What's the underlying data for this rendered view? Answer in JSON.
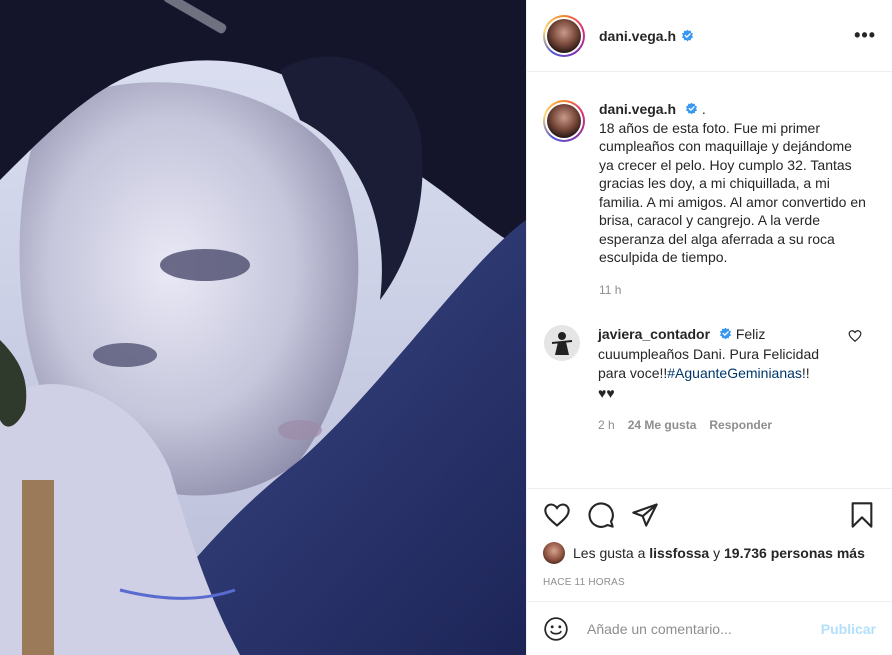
{
  "post": {
    "author": "dani.vega.h",
    "caption_suffix": ".",
    "caption_text": "18 años de esta foto. Fue mi primer cumpleaños con maquillaje y dejándome ya crecer el pelo. Hoy cumplo 32. Tantas gracias les doy, a mi chiquillada, a mi familia. A mi amigos. Al amor convertido en brisa, caracol y cangrejo. A la verde esperanza del alga aferrada a su roca esculpida de tiempo.",
    "caption_time": "11 h"
  },
  "comment": {
    "author": "javiera_contador",
    "text_before": "Feliz cuuumpleaños Dani. Pura Felicidad para voce!!",
    "hashtag": "#AguanteGeminianas",
    "text_after": "!! ♥♥",
    "time": "2 h",
    "likes": "24 Me gusta",
    "reply_label": "Responder"
  },
  "likes": {
    "prefix": "Les gusta a",
    "user": "lissfossa",
    "middle": "y",
    "count": "19.736 personas más"
  },
  "posted_ago": "HACE 11 HORAS",
  "add_comment": {
    "placeholder": "Añade un comentario...",
    "publish_label": "Publicar"
  },
  "icons": [
    "more-options-icon",
    "verified-icon",
    "heart-icon",
    "comment-icon",
    "share-icon",
    "save-icon",
    "emoji-icon"
  ],
  "colors": {
    "verified": "#3897f0",
    "link": "#00376b",
    "publish_disabled": "#b2dffc",
    "muted": "#8e8e8e"
  }
}
